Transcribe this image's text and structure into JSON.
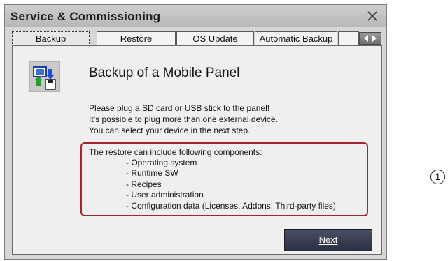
{
  "window": {
    "title": "Service & Commissioning"
  },
  "tabs": [
    {
      "label": "Backup",
      "active": true
    },
    {
      "label": "Restore",
      "active": false
    },
    {
      "label": "OS Update",
      "active": false
    },
    {
      "label": "Automatic Backup",
      "active": false
    }
  ],
  "panel": {
    "heading": "Backup of a Mobile Panel",
    "info_lines": [
      "Please plug a SD card or USB stick to the panel!",
      "It’s possible to plug more than one external device.",
      "You can select your device in the next step."
    ],
    "components_header": "The restore can include following components:",
    "components": [
      "- Operating system",
      "- Runtime SW",
      "- Recipes",
      "- User administration",
      "- Configuration data (Licenses, Addons, Third-party files)"
    ],
    "next_label": "Next"
  },
  "callout": {
    "number": "1"
  },
  "colors": {
    "highlight_border": "#a6262e",
    "button_bg": "#2f3446",
    "icon_arrow_blue": "#1f4fd6",
    "icon_arrow_green": "#2c9a2c"
  },
  "icons": {
    "app": "backup-device-icon",
    "close": "close-icon"
  }
}
